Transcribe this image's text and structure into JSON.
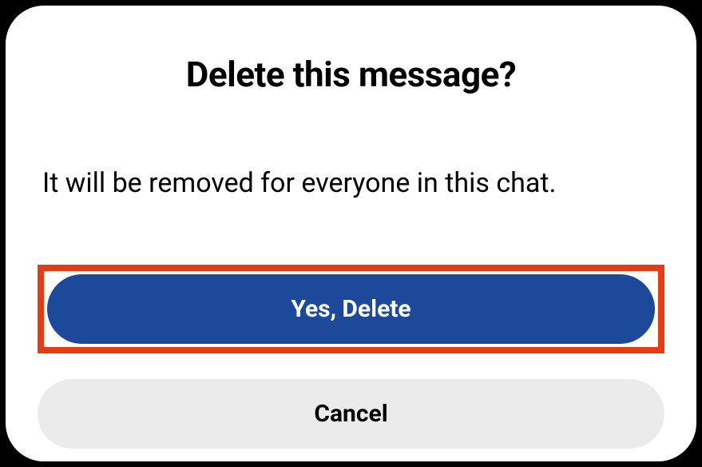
{
  "dialog": {
    "title": "Delete this message?",
    "description": "It will be removed for everyone in this chat.",
    "confirm_label": "Yes, Delete",
    "cancel_label": "Cancel"
  }
}
